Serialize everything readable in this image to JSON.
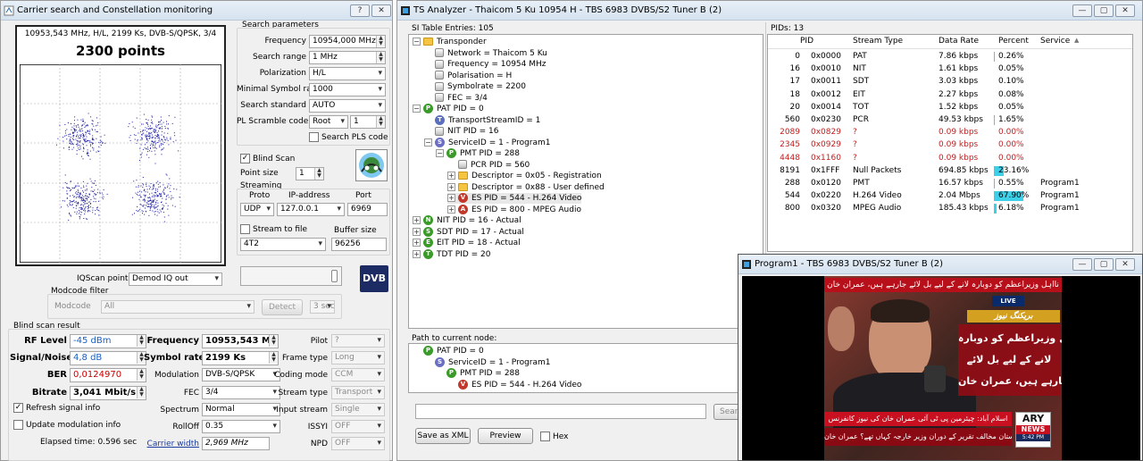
{
  "win1": {
    "title": "Carrier search and Constellation monitoring",
    "help": "?",
    "close": "✕",
    "plot_info": "10953,543 MHz, H/L, 2199 Ks, DVB-S/QPSK, 3/4",
    "plot_points": "2300 points",
    "search_params_title": "Search parameters",
    "params": [
      {
        "label": "Frequency",
        "value": "10954,000 MHz",
        "type": "spin"
      },
      {
        "label": "Search range",
        "value": "1 MHz",
        "type": "spin"
      },
      {
        "label": "Polarization",
        "value": "H/L",
        "type": "select"
      },
      {
        "label": "Minimal Symbol rate",
        "value": "1000",
        "type": "select"
      },
      {
        "label": "Search standard",
        "value": "AUTO",
        "type": "select"
      }
    ],
    "pl_label": "PL Scramble code",
    "pl_select": "Root",
    "pl_value": "1",
    "search_pls": "Search PLS code",
    "blind_scan": "Blind Scan",
    "point_size_label": "Point size",
    "point_size": "1",
    "streaming_title": "Streaming",
    "proto_label": "Proto",
    "ip_label": "IP-address",
    "port_label": "Port",
    "proto": "UDP",
    "ip": "127.0.0.1",
    "port": "6969",
    "stream_to_file": "Stream to file",
    "buffer_label": "Buffer size",
    "file_select": "4T2",
    "buffer": "96256",
    "iqscan_label": "IQScan point",
    "iqscan_value": "Demod IQ out",
    "modcode_filter": "Modcode filter",
    "modcode_label": "Modcode",
    "modcode_value": "All",
    "detect": "Detect",
    "detect_time": "3 sec",
    "dvb_logo": "DVB",
    "result_title": "Blind scan result",
    "rf_level_label": "RF Level",
    "rf_level": "-45 dBm",
    "sn_label": "Signal/Noise",
    "sn": "4,8 dB",
    "ber_label": "BER",
    "ber": "0,0124970",
    "bitrate_label": "Bitrate",
    "bitrate": "3,041 Mbit/s",
    "freq_label": "Frequency",
    "freq": "10953,543 MHz",
    "sr_label": "Symbol rate",
    "sr": "2199 Ks",
    "modulation_label": "Modulation",
    "modulation": "DVB-S/QPSK",
    "fec_label": "FEC",
    "fec": "3/4",
    "spectrum_label": "Spectrum",
    "spectrum": "Normal",
    "rolloff_label": "RollOff",
    "rolloff": "0.35",
    "cw_label": "Carrier width",
    "cw": "2,969 MHz",
    "pilot_label": "Pilot",
    "pilot": "?",
    "frame_label": "Frame type",
    "frame": "Long",
    "coding_label": "Coding mode",
    "coding": "CCM",
    "stype_label": "Stream type",
    "stype": "Transport",
    "istream_label": "Input stream",
    "istream": "Single",
    "issyi_label": "ISSYI",
    "issyi": "OFF",
    "npd_label": "NPD",
    "npd": "OFF",
    "refresh": "Refresh signal info",
    "update_mod": "Update modulation info",
    "elapsed": "Elapsed time: 0.596 sec"
  },
  "win2": {
    "title": "TS Analyzer - Thaicom 5 Ku 10954 H - TBS 6983 DVBS/S2 Tuner B (2)",
    "si_header": "SI Table Entries: 105",
    "tree": [
      {
        "d": 0,
        "e": "−",
        "i": "fold",
        "t": "Transponder"
      },
      {
        "d": 1,
        "i": "sq",
        "t": "Network = Thaicom 5 Ku"
      },
      {
        "d": 1,
        "i": "sq",
        "t": "Frequency = 10954 MHz"
      },
      {
        "d": 1,
        "i": "sq",
        "t": "Polarisation = H"
      },
      {
        "d": 1,
        "i": "sq",
        "t": "Symbolrate = 2200"
      },
      {
        "d": 1,
        "i": "sq",
        "t": "FEC = 3/4"
      },
      {
        "d": 0,
        "e": "−",
        "i": "P",
        "c": "#3a9a2a",
        "t": "PAT PID = 0"
      },
      {
        "d": 1,
        "i": "T",
        "c": "#5b6fbf",
        "t": "TransportStreamID = 1"
      },
      {
        "d": 1,
        "i": "sq",
        "t": "NIT PID = 16"
      },
      {
        "d": 1,
        "e": "−",
        "i": "S",
        "c": "#6b6fc4",
        "t": "ServiceID = 1 - Program1"
      },
      {
        "d": 2,
        "e": "−",
        "i": "P",
        "c": "#3a9a2a",
        "t": "PMT PID = 288"
      },
      {
        "d": 3,
        "i": "sq",
        "t": "PCR PID = 560"
      },
      {
        "d": 3,
        "e": "+",
        "i": "fold",
        "t": "Descriptor = 0x05 - Registration"
      },
      {
        "d": 3,
        "e": "+",
        "i": "fold",
        "t": "Descriptor = 0x88 - User defined"
      },
      {
        "d": 3,
        "e": "+",
        "i": "V",
        "c": "#c0392b",
        "t": "ES PID = 544 - H.264 Video",
        "hl": true
      },
      {
        "d": 3,
        "e": "+",
        "i": "A",
        "c": "#c0392b",
        "t": "ES PID = 800 - MPEG Audio"
      },
      {
        "d": 0,
        "e": "+",
        "i": "N",
        "c": "#3a9a2a",
        "t": "NIT PID = 16 - Actual"
      },
      {
        "d": 0,
        "e": "+",
        "i": "S",
        "c": "#3a9a2a",
        "t": "SDT PID = 17 - Actual"
      },
      {
        "d": 0,
        "e": "+",
        "i": "E",
        "c": "#3a9a2a",
        "t": "EIT PID = 18 - Actual"
      },
      {
        "d": 0,
        "e": "+",
        "i": "T",
        "c": "#3a9a2a",
        "t": "TDT PID = 20"
      }
    ],
    "path_header": "Path to current node:",
    "path": [
      {
        "d": 0,
        "i": "P",
        "c": "#3a9a2a",
        "t": "PAT PID = 0"
      },
      {
        "d": 1,
        "i": "S",
        "c": "#6b6fc4",
        "t": "ServiceID = 1 - Program1"
      },
      {
        "d": 2,
        "i": "P",
        "c": "#3a9a2a",
        "t": "PMT PID = 288"
      },
      {
        "d": 3,
        "i": "V",
        "c": "#c0392b",
        "t": "ES PID = 544 - H.264 Video"
      }
    ],
    "search_btn": "Search",
    "save_xml": "Save as XML",
    "preview": "Preview",
    "hex": "Hex",
    "pids_header": "PIDs: 13",
    "cols": [
      "PID",
      "Stream Type",
      "Data Rate",
      "Percent",
      "Service"
    ],
    "rows": [
      {
        "pid": "0",
        "hex": "0x0000",
        "type": "PAT",
        "rate": "7.86 kbps",
        "pct": "0.26%",
        "pv": 0.26,
        "svc": ""
      },
      {
        "pid": "16",
        "hex": "0x0010",
        "type": "NIT",
        "rate": "1.61 kbps",
        "pct": "0.05%",
        "pv": 0.05,
        "svc": ""
      },
      {
        "pid": "17",
        "hex": "0x0011",
        "type": "SDT",
        "rate": "3.03 kbps",
        "pct": "0.10%",
        "pv": 0.1,
        "svc": ""
      },
      {
        "pid": "18",
        "hex": "0x0012",
        "type": "EIT",
        "rate": "2.27 kbps",
        "pct": "0.08%",
        "pv": 0.08,
        "svc": ""
      },
      {
        "pid": "20",
        "hex": "0x0014",
        "type": "TOT",
        "rate": "1.52 kbps",
        "pct": "0.05%",
        "pv": 0.05,
        "svc": ""
      },
      {
        "pid": "560",
        "hex": "0x0230",
        "type": "PCR",
        "rate": "49.53 kbps",
        "pct": "1.65%",
        "pv": 1.65,
        "svc": ""
      },
      {
        "pid": "2089",
        "hex": "0x0829",
        "type": "?",
        "rate": "0.09 kbps",
        "pct": "0.00%",
        "pv": 0,
        "svc": "",
        "red": true
      },
      {
        "pid": "2345",
        "hex": "0x0929",
        "type": "?",
        "rate": "0.09 kbps",
        "pct": "0.00%",
        "pv": 0,
        "svc": "",
        "red": true
      },
      {
        "pid": "4448",
        "hex": "0x1160",
        "type": "?",
        "rate": "0.09 kbps",
        "pct": "0.00%",
        "pv": 0,
        "svc": "",
        "red": true
      },
      {
        "pid": "8191",
        "hex": "0x1FFF",
        "type": "Null Packets",
        "rate": "694.85 kbps",
        "pct": "23.16%",
        "pv": 23.16,
        "svc": ""
      },
      {
        "pid": "288",
        "hex": "0x0120",
        "type": "PMT",
        "rate": "16.57 kbps",
        "pct": "0.55%",
        "pv": 0.55,
        "svc": "Program1"
      },
      {
        "pid": "544",
        "hex": "0x0220",
        "type": "H.264 Video",
        "rate": "2.04 Mbps",
        "pct": "67.90%",
        "pv": 67.9,
        "svc": "Program1"
      },
      {
        "pid": "800",
        "hex": "0x0320",
        "type": "MPEG Audio",
        "rate": "185.43 kbps",
        "pct": "6.18%",
        "pv": 6.18,
        "svc": "Program1"
      }
    ]
  },
  "win3": {
    "title": "Program1 - TBS 6983 DVBS/S2 Tuner B (2)",
    "video": {
      "top_ticker": "نااہل وزیراعظم کو دوبارہ لانے کے لیے بل لائے جارہے ہیں، عمران خان",
      "breaking": "بریکنگ نیوز",
      "live": "LIVE",
      "headline": [
        "نااہل وزیراعظم کو دوبارہ",
        "لانے کے لیے بل لائے",
        "جارہے ہیں، عمران خان"
      ],
      "news_bar": "اسلام آباد: چیئرمین پی ٹی آئی عمران خان کی نیوز کانفرنس",
      "bottom_bar": "ٹرمپ کی پاکستان مخالف تقریر کے دوران وزیر خارجہ کہاں تھے؟ عمران خان",
      "ary": "ARY",
      "news": "NEWS",
      "time": "5:42 PM"
    }
  }
}
